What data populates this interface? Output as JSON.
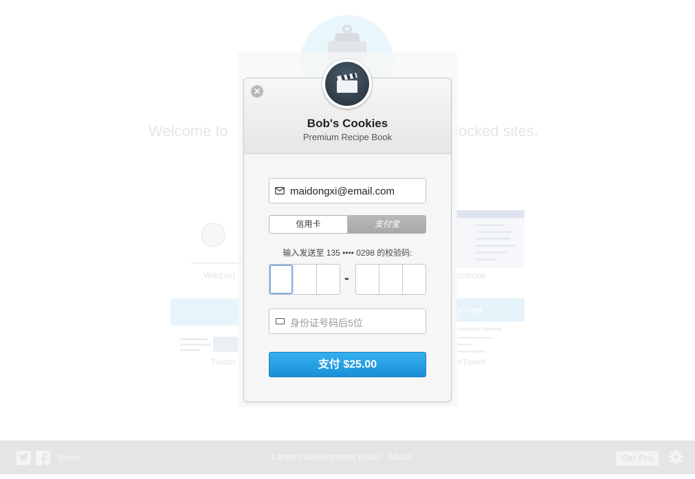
{
  "background": {
    "welcome_left": "Welcome to",
    "welcome_right": "locked sites.",
    "thumbs": {
      "wikipedia_caption": "Wikiped",
      "facebook_caption": "cebook",
      "twitter_caption": "Twitter",
      "freetweet_caption": "eTweet",
      "freetweet_banner": "eTweet",
      "freetweet_subtitle": "Unblocked Tweeting"
    }
  },
  "footer": {
    "share_label": "Share",
    "center_text": "Lantern development (now) · About",
    "get_pro_label": "Get Pro",
    "icons": [
      "twitter-icon",
      "facebook-icon",
      "gear-icon"
    ]
  },
  "modal": {
    "close_glyph": "✕",
    "merchant_name": "Bob's Cookies",
    "product_name": "Premium Recipe Book",
    "email": {
      "value": "maidongxi@email.com",
      "icon": "mail-icon"
    },
    "payment_tabs": {
      "credit_card_label": "信用卡",
      "alipay_label": "支付宝",
      "selected": "alipay"
    },
    "verify_label": "输入发送至 135 •••• 0298 的校验码:",
    "code_separator": "-",
    "id_field": {
      "placeholder": "身份证号码后5位",
      "icon": "id-card-icon"
    },
    "pay_button_label": "支付 $25.00"
  },
  "colors": {
    "pay_button": "#1a8fd6",
    "selected_tab": "#b1b1b1",
    "focus_ring": "#7eb0e3"
  }
}
